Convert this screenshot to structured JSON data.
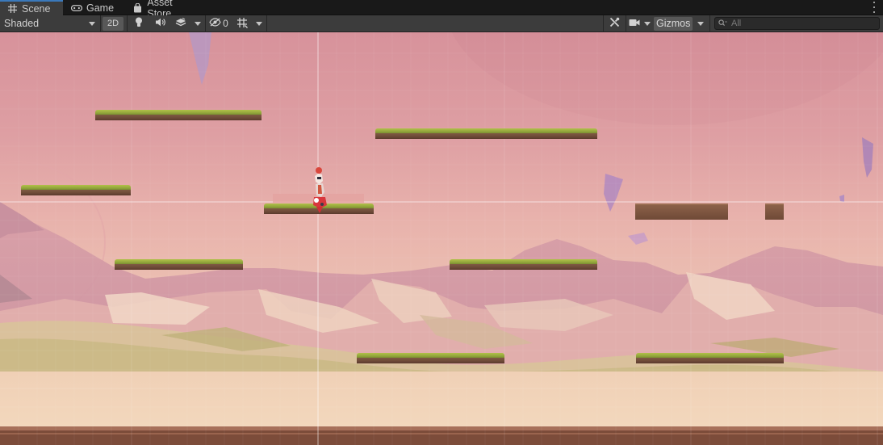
{
  "tabs": [
    {
      "label": "Scene",
      "icon": "grid-icon",
      "active": true
    },
    {
      "label": "Game",
      "icon": "gamepad-icon",
      "active": false
    },
    {
      "label": "Asset Store",
      "icon": "shopping-bag-icon",
      "active": false
    }
  ],
  "toolbar": {
    "draw_mode": "Shaded",
    "mode_2d": "2D",
    "hidden_count": "0",
    "gizmos": "Gizmos",
    "search_placeholder": "All"
  },
  "icons": {
    "lighting": "lightbulb-icon",
    "audio": "speaker-icon",
    "effects": "layers-icon",
    "visibility": "eye-slash-icon",
    "grid": "grid-snap-icon",
    "tools": "tools-icon",
    "camera": "camera-icon",
    "search": "search-icon",
    "more": "kebab-menu-icon"
  },
  "colors": {
    "toolbar_bg": "#3c3c3c",
    "tabbar_bg": "#191919",
    "active_tab_accent": "#3a79bb",
    "sky_top": "#d7929b",
    "sky_bottom": "#f2d2b6",
    "grass": "#a3b443",
    "dirt": "#6f4a37"
  }
}
